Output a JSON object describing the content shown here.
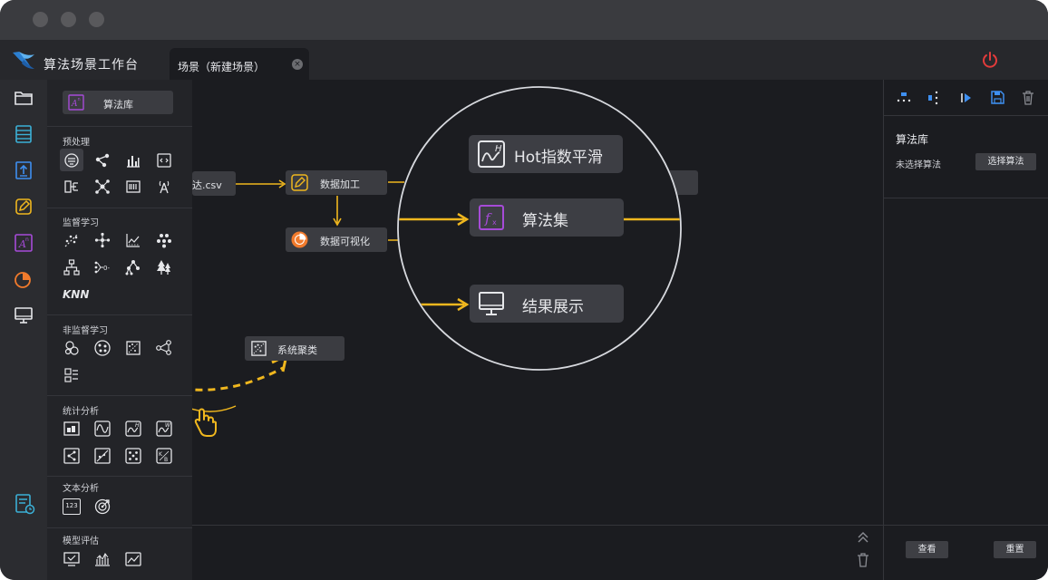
{
  "app": {
    "title": "算法场景工作台"
  },
  "tab": {
    "label": "场景（新建场景）",
    "close": "×"
  },
  "palette": {
    "library_label": "算法库",
    "sections": {
      "preprocess": "预处理",
      "supervised": "监督学习",
      "unsupervised": "非监督学习",
      "stats": "统计分析",
      "text": "文本分析",
      "eval": "模型评估"
    },
    "knn": "KNN",
    "counter": "123"
  },
  "canvas": {
    "source_node": "达.csv",
    "process_node": "数据加工",
    "viz_node": "数据可视化",
    "drag_node": "系统聚类"
  },
  "magnifier": {
    "hot": "Hot指数平滑",
    "algoset": "算法集",
    "result": "结果展示"
  },
  "right_panel": {
    "title": "算法库",
    "status": "未选择算法",
    "select_button": "选择算法",
    "view_button": "查看",
    "reset_button": "重置"
  },
  "colors": {
    "accent": "#f0b71e",
    "purple": "#a64bd8",
    "orange": "#f07a2c",
    "cyan": "#3bb0d6",
    "blue": "#3e8ff0",
    "power": "#e23b3b"
  }
}
